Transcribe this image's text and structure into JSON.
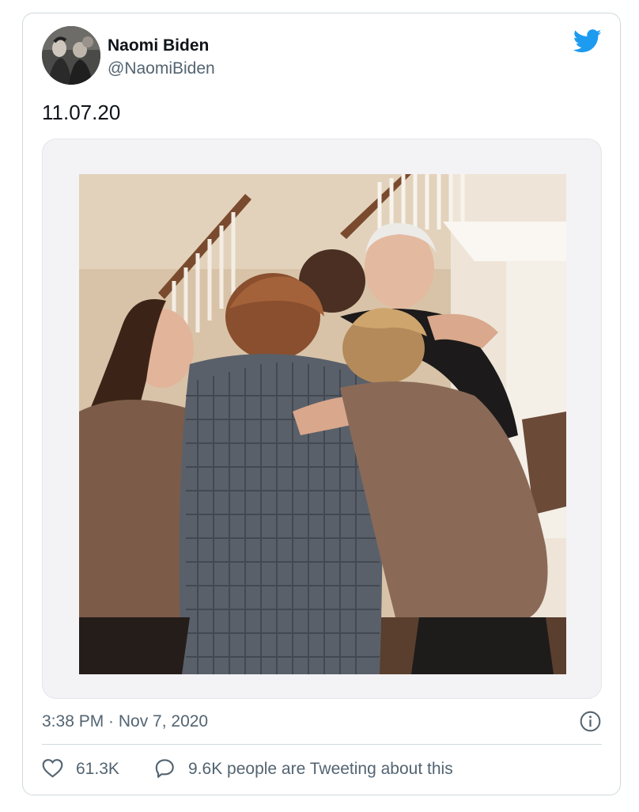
{
  "author": {
    "name": "Naomi Biden",
    "handle": "@NaomiBiden",
    "avatar_icon": "profile-photo"
  },
  "brand_icon": "twitter-bird-icon",
  "tweet": {
    "text": "11.07.20",
    "media": {
      "type": "photo",
      "frame_style": "instant-photo-frame"
    }
  },
  "meta": {
    "timestamp": "3:38 PM · Nov 7, 2020",
    "info_icon": "info-icon"
  },
  "engagement": {
    "likes_icon": "heart-icon",
    "likes": "61.3K",
    "conversation_icon": "speech-bubble-icon",
    "conversation_text": "9.6K people are Tweeting about this"
  },
  "colors": {
    "brand_blue": "#1d9bf0",
    "text_primary": "#0f1419",
    "text_secondary": "#536471",
    "border": "#cfd9de"
  }
}
